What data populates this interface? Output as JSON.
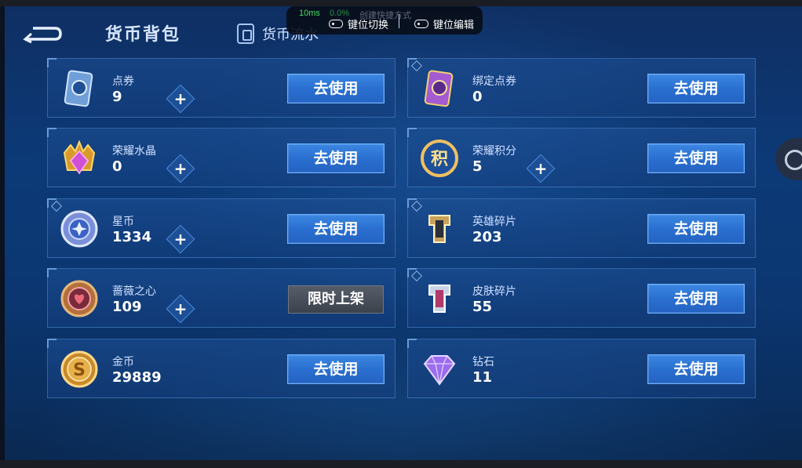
{
  "header": {
    "title": "货币背包",
    "flow_tab": "货币流水"
  },
  "overlay": {
    "ping": "10ms",
    "ping_extra": "0.0%",
    "ghost_text": "创建快捷方式",
    "switch_label": "键位切换",
    "edit_label": "键位编辑"
  },
  "currencies_left": [
    {
      "name": "点券",
      "amount": "9",
      "action": "去使用",
      "icon": "coupon-card-icon"
    },
    {
      "name": "荣耀水晶",
      "amount": "0",
      "action": "去使用",
      "icon": "glory-crystal-icon"
    },
    {
      "name": "星币",
      "amount": "1334",
      "action": "去使用",
      "icon": "star-coin-icon"
    },
    {
      "name": "蔷薇之心",
      "amount": "109",
      "action": "限时上架",
      "icon": "rose-heart-icon"
    },
    {
      "name": "金币",
      "amount": "29889",
      "action": "去使用",
      "icon": "gold-coin-icon"
    }
  ],
  "currencies_right": [
    {
      "name": "绑定点券",
      "amount": "0",
      "action": "去使用",
      "icon": "bound-coupon-icon"
    },
    {
      "name": "荣耀积分",
      "amount": "5",
      "action": "去使用",
      "icon": "glory-points-icon"
    },
    {
      "name": "英雄碎片",
      "amount": "203",
      "action": "去使用",
      "icon": "hero-fragment-icon"
    },
    {
      "name": "皮肤碎片",
      "amount": "55",
      "action": "去使用",
      "icon": "skin-fragment-icon"
    },
    {
      "name": "钻石",
      "amount": "11",
      "action": "去使用",
      "icon": "diamond-icon"
    }
  ],
  "icon_text": {
    "glory_points": "积",
    "gold_coin": "S"
  },
  "colors": {
    "use_button": "#2a6fd0",
    "limited_button": "#4a505b",
    "background": "#0c3a78"
  }
}
